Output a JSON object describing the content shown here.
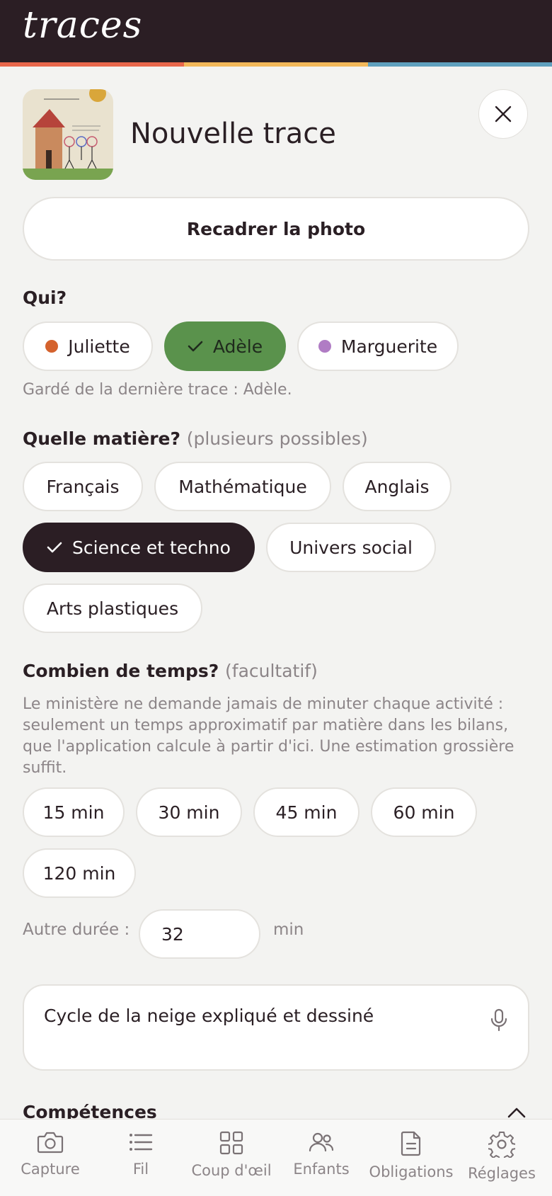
{
  "app": {
    "logo": "traces",
    "stripe_colors": [
      "#e8674b",
      "#f2b85a",
      "#5fa0be"
    ]
  },
  "header": {
    "title": "Nouvelle trace",
    "thumbnail_alt": "child drawing of a house and people"
  },
  "recadrer_label": "Recadrer la photo",
  "qui": {
    "label": "Qui?",
    "children": [
      {
        "name": "Juliette",
        "color": "#d4622d",
        "selected": false
      },
      {
        "name": "Adèle",
        "color": "#5a924c",
        "selected": true
      },
      {
        "name": "Marguerite",
        "color": "#b07cc4",
        "selected": false
      }
    ],
    "hint": "Gardé de la dernière trace : Adèle."
  },
  "matiere": {
    "label": "Quelle matière?",
    "sub": "(plusieurs possibles)",
    "subjects": [
      {
        "name": "Français",
        "selected": false
      },
      {
        "name": "Mathématique",
        "selected": false
      },
      {
        "name": "Anglais",
        "selected": false
      },
      {
        "name": "Science et techno",
        "selected": true
      },
      {
        "name": "Univers social",
        "selected": false
      },
      {
        "name": "Arts plastiques",
        "selected": false
      }
    ]
  },
  "temps": {
    "label": "Combien de temps?",
    "sub": "(facultatif)",
    "description": "Le ministère ne demande jamais de minuter chaque activité : seulement un temps approximatif par matière dans les bilans, que l'application calcule à partir d'ici. Une estimation grossière suffit.",
    "options": [
      "15 min",
      "30 min",
      "45 min",
      "60 min",
      "120 min"
    ],
    "autre_label": "Autre durée :",
    "autre_value": "32",
    "autre_unit": "min"
  },
  "note": {
    "value": "Cycle de la neige expliqué et dessiné"
  },
  "competences_label": "Compétences",
  "nav": [
    {
      "label": "Capture",
      "icon": "camera-icon"
    },
    {
      "label": "Fil",
      "icon": "list-icon"
    },
    {
      "label": "Coup d'œil",
      "icon": "grid-icon"
    },
    {
      "label": "Enfants",
      "icon": "people-icon"
    },
    {
      "label": "Obligations",
      "icon": "document-icon"
    },
    {
      "label": "Réglages",
      "icon": "gear-icon"
    }
  ]
}
